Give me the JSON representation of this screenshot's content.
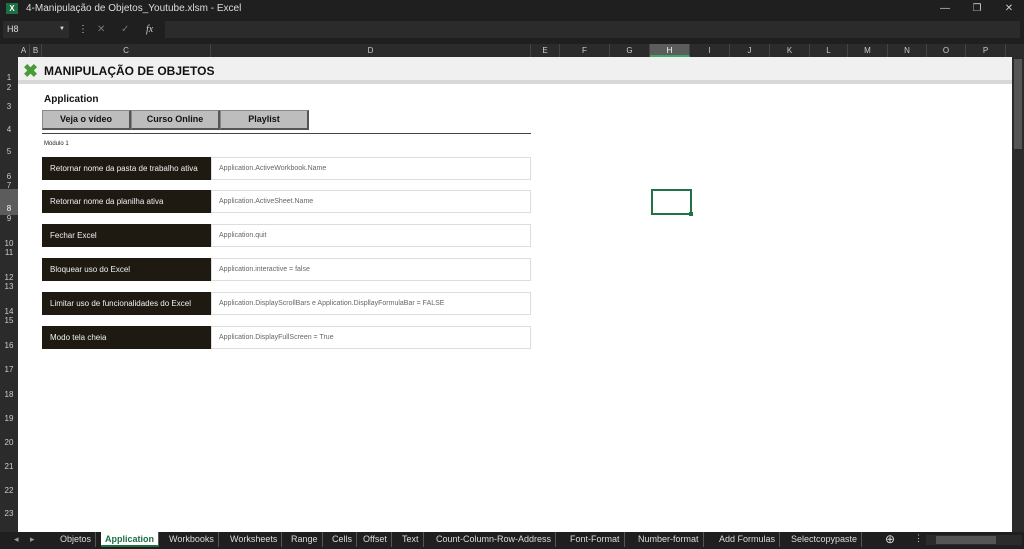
{
  "window": {
    "title": "4-Manipulação de Objetos_Youtube.xlsm - Excel",
    "app_icon": "excel-icon",
    "controls": [
      "—",
      "❐",
      "✕"
    ]
  },
  "formula_bar": {
    "name_box": "H8",
    "cancel": "✕",
    "enter": "✓",
    "fx": "fx",
    "value": ""
  },
  "columns": [
    "A",
    "B",
    "C",
    "D",
    "E",
    "F",
    "G",
    "H",
    "I",
    "J",
    "K",
    "L",
    "M",
    "N",
    "O",
    "P"
  ],
  "selected_column": "H",
  "rows": [
    "1",
    "2",
    "3",
    "4",
    "5",
    "6",
    "7",
    "8",
    "9",
    "10",
    "11",
    "12",
    "13",
    "14",
    "15",
    "16",
    "17",
    "18",
    "19",
    "20",
    "21",
    "22",
    "23"
  ],
  "selected_row": "8",
  "sheet": {
    "banner_title": "MANIPULAÇÃO DE OBJETOS",
    "heading": "Application",
    "buttons": [
      "Veja o vídeo",
      "Curso Online",
      "Playlist"
    ],
    "module_label": "Módulo 1",
    "items": [
      {
        "label": "Retornar nome da pasta de trabalho ativa",
        "code": "Application.ActiveWorkbook.Name"
      },
      {
        "label": "Retornar nome da planilha ativa",
        "code": "Application.ActiveSheet.Name"
      },
      {
        "label": "Fechar Excel",
        "code": "Application.quit"
      },
      {
        "label": "Bloquear uso do Excel",
        "code": "Application.interactive = false"
      },
      {
        "label": "Limitar uso de funcionalidades do Excel",
        "code": "Application.DisplayScrollBars e Application.DispllayFormulaBar = FALSE"
      },
      {
        "label": "Modo tela cheia",
        "code": "Application.DisplayFullScreen = True"
      }
    ]
  },
  "tabs": [
    "Objetos",
    "Application",
    "Workbooks",
    "Worksheets",
    "Range",
    "Cells",
    "Offset",
    "Text",
    "Count-Column-Row-Address",
    "Font-Format",
    "Number-format",
    "Add Formulas",
    "Selectcopypaste"
  ],
  "active_tab": "Application",
  "colors": {
    "accent": "#1d6f42",
    "label_bg": "#1e1a12"
  }
}
